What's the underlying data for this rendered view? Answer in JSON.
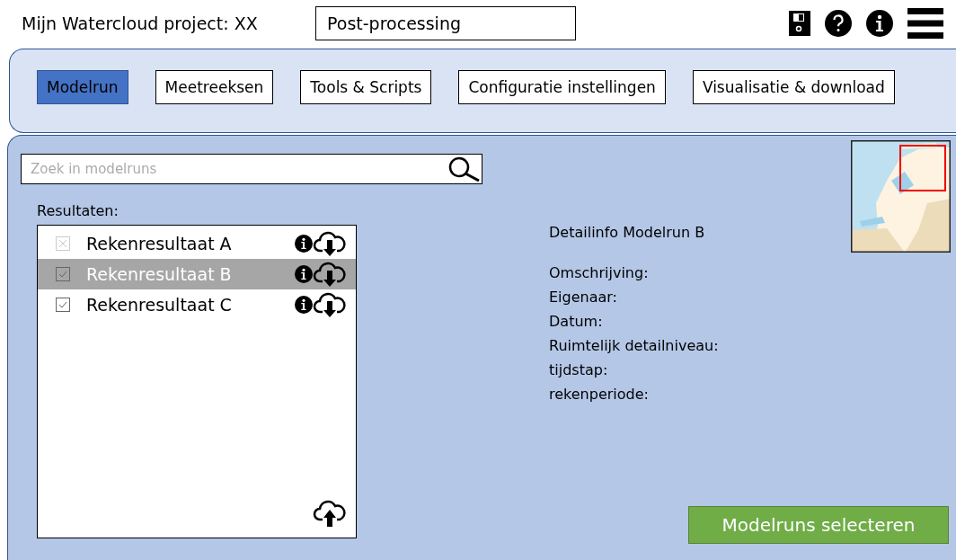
{
  "header": {
    "title": "Mijn Watercloud project: XX",
    "section": "Post-processing"
  },
  "tabs": [
    {
      "label": "Modelrun",
      "selected": true
    },
    {
      "label": "Meetreeksen",
      "selected": false
    },
    {
      "label": "Tools & Scripts",
      "selected": false
    },
    {
      "label": "Configuratie instellingen",
      "selected": false
    },
    {
      "label": "Visualisatie & download",
      "selected": false
    }
  ],
  "search": {
    "placeholder": "Zoek in modelruns"
  },
  "results": {
    "label": "Resultaten:",
    "items": [
      {
        "label": "Rekenresultaat A",
        "checked": false,
        "selected": false
      },
      {
        "label": "Rekenresultaat B",
        "checked": true,
        "selected": true
      },
      {
        "label": "Rekenresultaat C",
        "checked": true,
        "selected": false
      }
    ]
  },
  "detail": {
    "title": "Detailinfo Modelrun B",
    "fields": [
      "Omschrijving:",
      "Eigenaar:",
      "Datum:",
      "Ruimtelijk detailniveau:",
      "tijdstap:",
      "rekenperiode:"
    ]
  },
  "action": {
    "label": "Modelruns selecteren"
  }
}
